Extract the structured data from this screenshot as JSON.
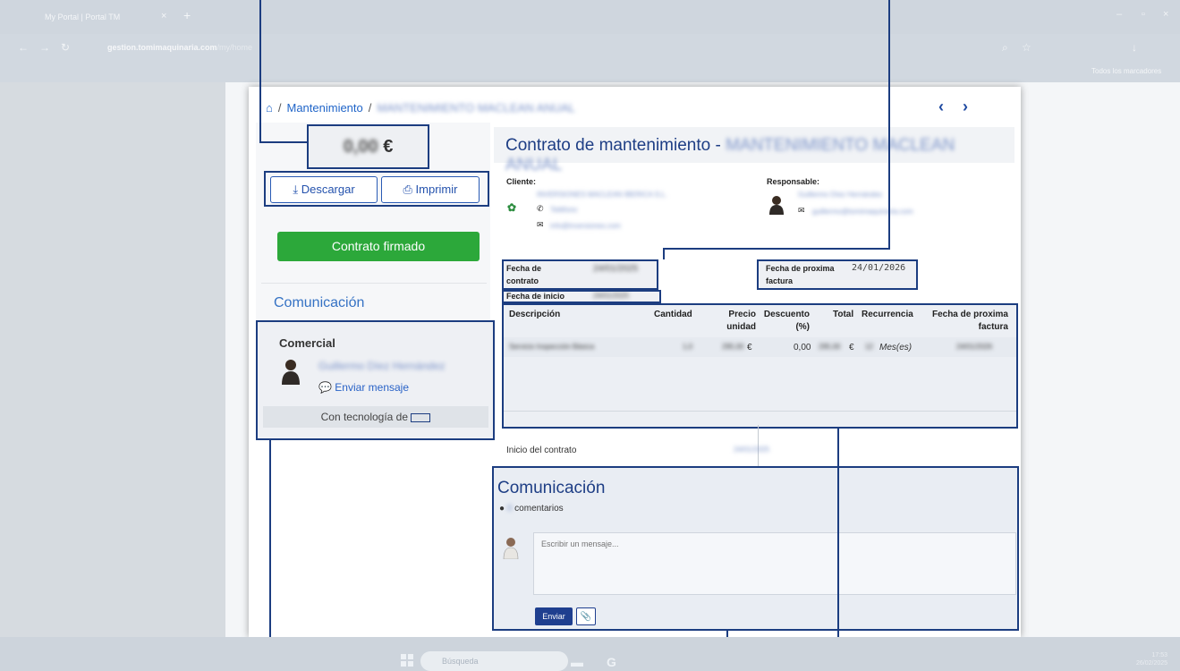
{
  "browser": {
    "tab_title": "My Portal | Portal TM",
    "url_host": "gestion.tomimaquinaria.com",
    "url_path": "/my/home",
    "bookmarks_label": "Todos los marcadores"
  },
  "breadcrumb": {
    "section": "Mantenimiento",
    "current": "MANTENIMIENTO MACLEAN ANUAL"
  },
  "price": {
    "amount": "0,00",
    "currency": "€"
  },
  "actions": {
    "download_label": "Descargar",
    "print_label": "Imprimir",
    "signed_label": "Contrato firmado"
  },
  "sidebar": {
    "communication_title": "Comunicación",
    "commercial_label": "Comercial",
    "commercial_name": "Guillermo Díez Hernández",
    "send_message_label": "Enviar mensaje",
    "powered_by": "Con tecnología de"
  },
  "contract": {
    "title_prefix": "Contrato de mantenimiento -",
    "title_name": "MANTENIMIENTO MACLEAN ANUAL",
    "client_label": "Cliente:",
    "client_name": "INVERSIONES MACLEAN IBERICA S.L.",
    "client_phone": "Teléfono",
    "client_email": "info@inversiones.com",
    "responsible_label": "Responsable:",
    "responsible_name": "Guillermo Díez Hernández",
    "responsible_email": "guillermo@tomimaquinaria.com",
    "contract_date_label": "Fecha de contrato",
    "contract_date_value": "24/01/2025",
    "start_date_label": "Fecha de inicio",
    "start_date_value": "24/01/2025",
    "next_invoice_label": "Fecha de proxima factura",
    "next_invoice_value": "24/01/2026"
  },
  "lines": {
    "headers": {
      "description": "Descripción",
      "quantity": "Cantidad",
      "unit_price": "Precio unidad",
      "discount": "Descuento (%)",
      "total": "Total",
      "recurrence": "Recurrencia",
      "next_invoice": "Fecha de proxima factura"
    },
    "rows": [
      {
        "description": "Servicio Inspección Básica",
        "quantity": "1,0",
        "unit_price": "295,00",
        "unit_price_currency": "€",
        "discount": "0,00",
        "total": "295,00",
        "total_currency": "€",
        "recurrence_count": "12",
        "recurrence_unit": "Mes(es)",
        "next_invoice": "24/01/2026"
      }
    ]
  },
  "contract_start": {
    "label": "Inicio del contrato",
    "value": "24/01/2025"
  },
  "communication": {
    "title": "Comunicación",
    "comments_count": "0",
    "comments_label": "comentarios",
    "placeholder": "Escribir un mensaje...",
    "send_label": "Enviar"
  },
  "taskbar": {
    "search_placeholder": "Búsqueda",
    "time": "17:53",
    "date": "26/02/2025"
  }
}
